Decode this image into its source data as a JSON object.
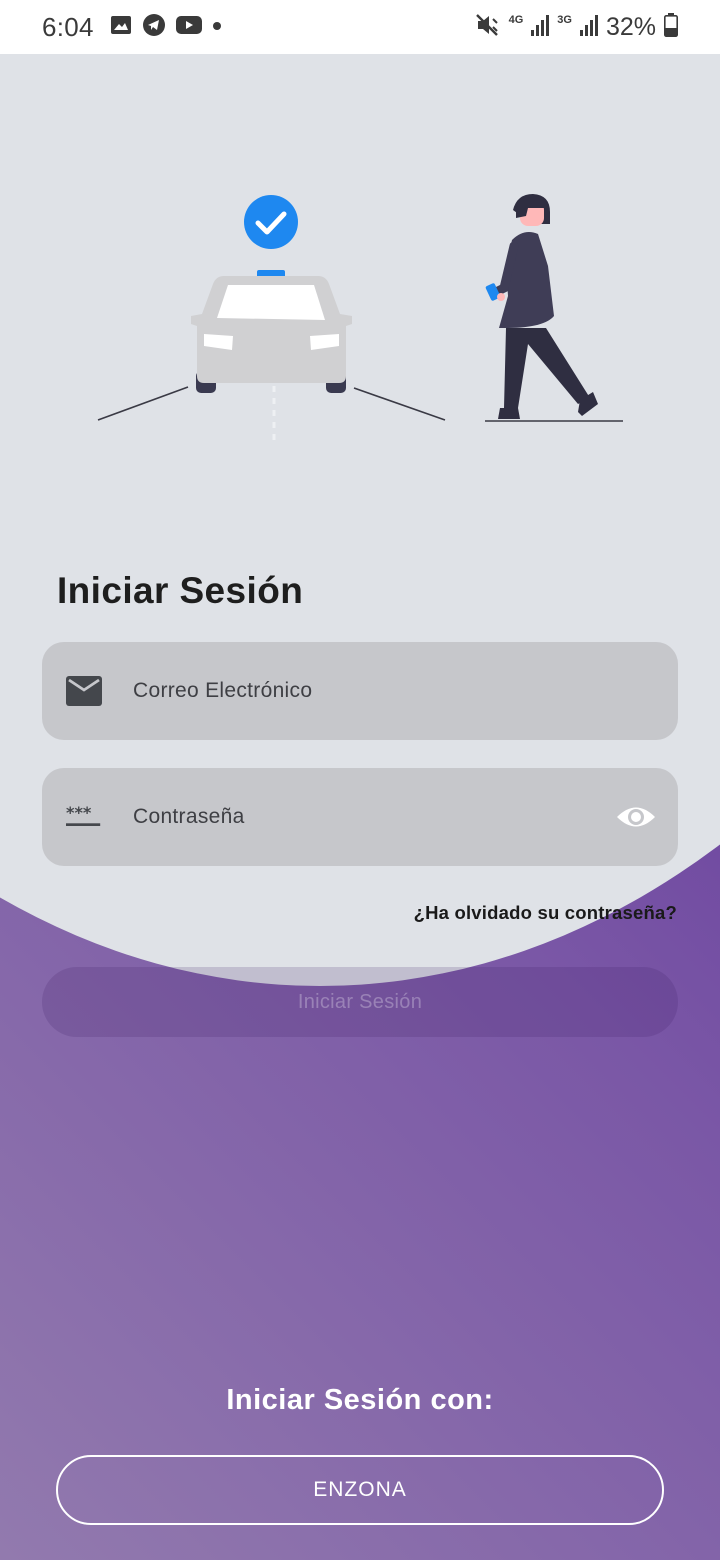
{
  "status_bar": {
    "time": "6:04",
    "network_4g": "4G",
    "network_3g": "3G",
    "battery": "32%",
    "icons": [
      "image-icon",
      "telegram-icon",
      "youtube-icon",
      "dot-icon",
      "mute-icon",
      "signal-icon",
      "battery-icon"
    ]
  },
  "login": {
    "title": "Iniciar Sesión",
    "email_placeholder": "Correo Electrónico",
    "password_placeholder": "Contraseña",
    "forgot_password": "¿Ha olvidado su contraseña?",
    "submit_label": "Iniciar Sesión"
  },
  "alt_login": {
    "label": "Iniciar Sesión con:",
    "enzona_label": "ENZONA"
  },
  "colors": {
    "accent_purple": "#5a2c96",
    "light_background": "#dfe2e7",
    "field_background": "#c6c7cb",
    "check_blue": "#1e88f0"
  }
}
